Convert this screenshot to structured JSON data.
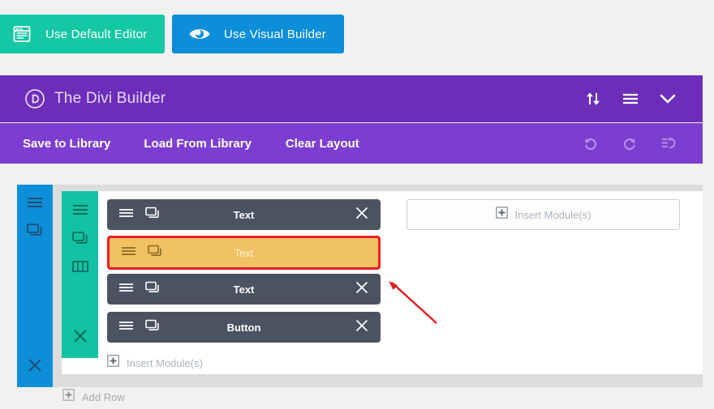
{
  "top_buttons": [
    {
      "id": "use-default-editor",
      "label": "Use Default Editor",
      "icon": "document-editor-icon",
      "color": "#15c8a4"
    },
    {
      "id": "use-visual-builder",
      "label": "Use Visual Builder",
      "icon": "eye-icon",
      "color": "#0c8ed8"
    }
  ],
  "builder_header": {
    "logo_letter": "D",
    "logo_icon": "divi-logo-icon",
    "title": "The Divi Builder",
    "background": "#6c2eb9",
    "icons": [
      {
        "id": "sort",
        "name": "sort-arrows-icon"
      },
      {
        "id": "menu",
        "name": "hamburger-menu-icon"
      },
      {
        "id": "collapse",
        "name": "chevron-down-icon"
      }
    ]
  },
  "builder_toolbar": {
    "background": "#7c3ed0",
    "links": [
      {
        "id": "save-to-library",
        "label": "Save to Library"
      },
      {
        "id": "load-from-library",
        "label": "Load From Library"
      },
      {
        "id": "clear-layout",
        "label": "Clear Layout"
      }
    ],
    "icons": [
      {
        "id": "undo",
        "name": "undo-icon"
      },
      {
        "id": "redo",
        "name": "redo-icon"
      },
      {
        "id": "history",
        "name": "history-icon"
      }
    ]
  },
  "section": {
    "color": "#0c8ed8",
    "icons": [
      {
        "id": "section-settings",
        "name": "hamburger-settings-icon"
      },
      {
        "id": "section-clone",
        "name": "clone-icon"
      }
    ],
    "close_icon": "close-icon"
  },
  "row": {
    "color": "#12c2a3",
    "icons": [
      {
        "id": "row-settings",
        "name": "hamburger-settings-icon"
      },
      {
        "id": "row-clone",
        "name": "clone-icon"
      },
      {
        "id": "row-columns",
        "name": "columns-icon"
      }
    ],
    "close_icon": "close-icon"
  },
  "modules": [
    {
      "label": "Text",
      "selected": false,
      "settings_icon": "hamburger-settings-icon",
      "clone_icon": "clone-icon",
      "close_icon": "close-icon"
    },
    {
      "label": "Text",
      "selected": true,
      "settings_icon": "hamburger-settings-icon",
      "clone_icon": "clone-icon",
      "close_icon": ""
    },
    {
      "label": "Text",
      "selected": false,
      "settings_icon": "hamburger-settings-icon",
      "clone_icon": "clone-icon",
      "close_icon": "close-icon"
    },
    {
      "label": "Button",
      "selected": false,
      "settings_icon": "hamburger-settings-icon",
      "clone_icon": "clone-icon",
      "close_icon": "close-icon"
    }
  ],
  "insert_module_box": {
    "label": "Insert Module(s)",
    "icon": "plus-square-icon"
  },
  "insert_module_inline": {
    "label": "Insert Module(s)",
    "icon": "plus-square-icon"
  },
  "add_row": {
    "label": "Add Row",
    "icon": "plus-square-icon"
  },
  "annotation": {
    "type": "arrow",
    "color": "#e31c24",
    "points": "tip(480,347) tail(536,398)"
  },
  "colors": {
    "page_background": "#f1f1f1",
    "module_background": "#4a5360",
    "module_selected_background": "#f0c263",
    "module_selected_border": "#ee1c25",
    "section_background": "#dcdcdc",
    "row_background": "#ffffff"
  }
}
